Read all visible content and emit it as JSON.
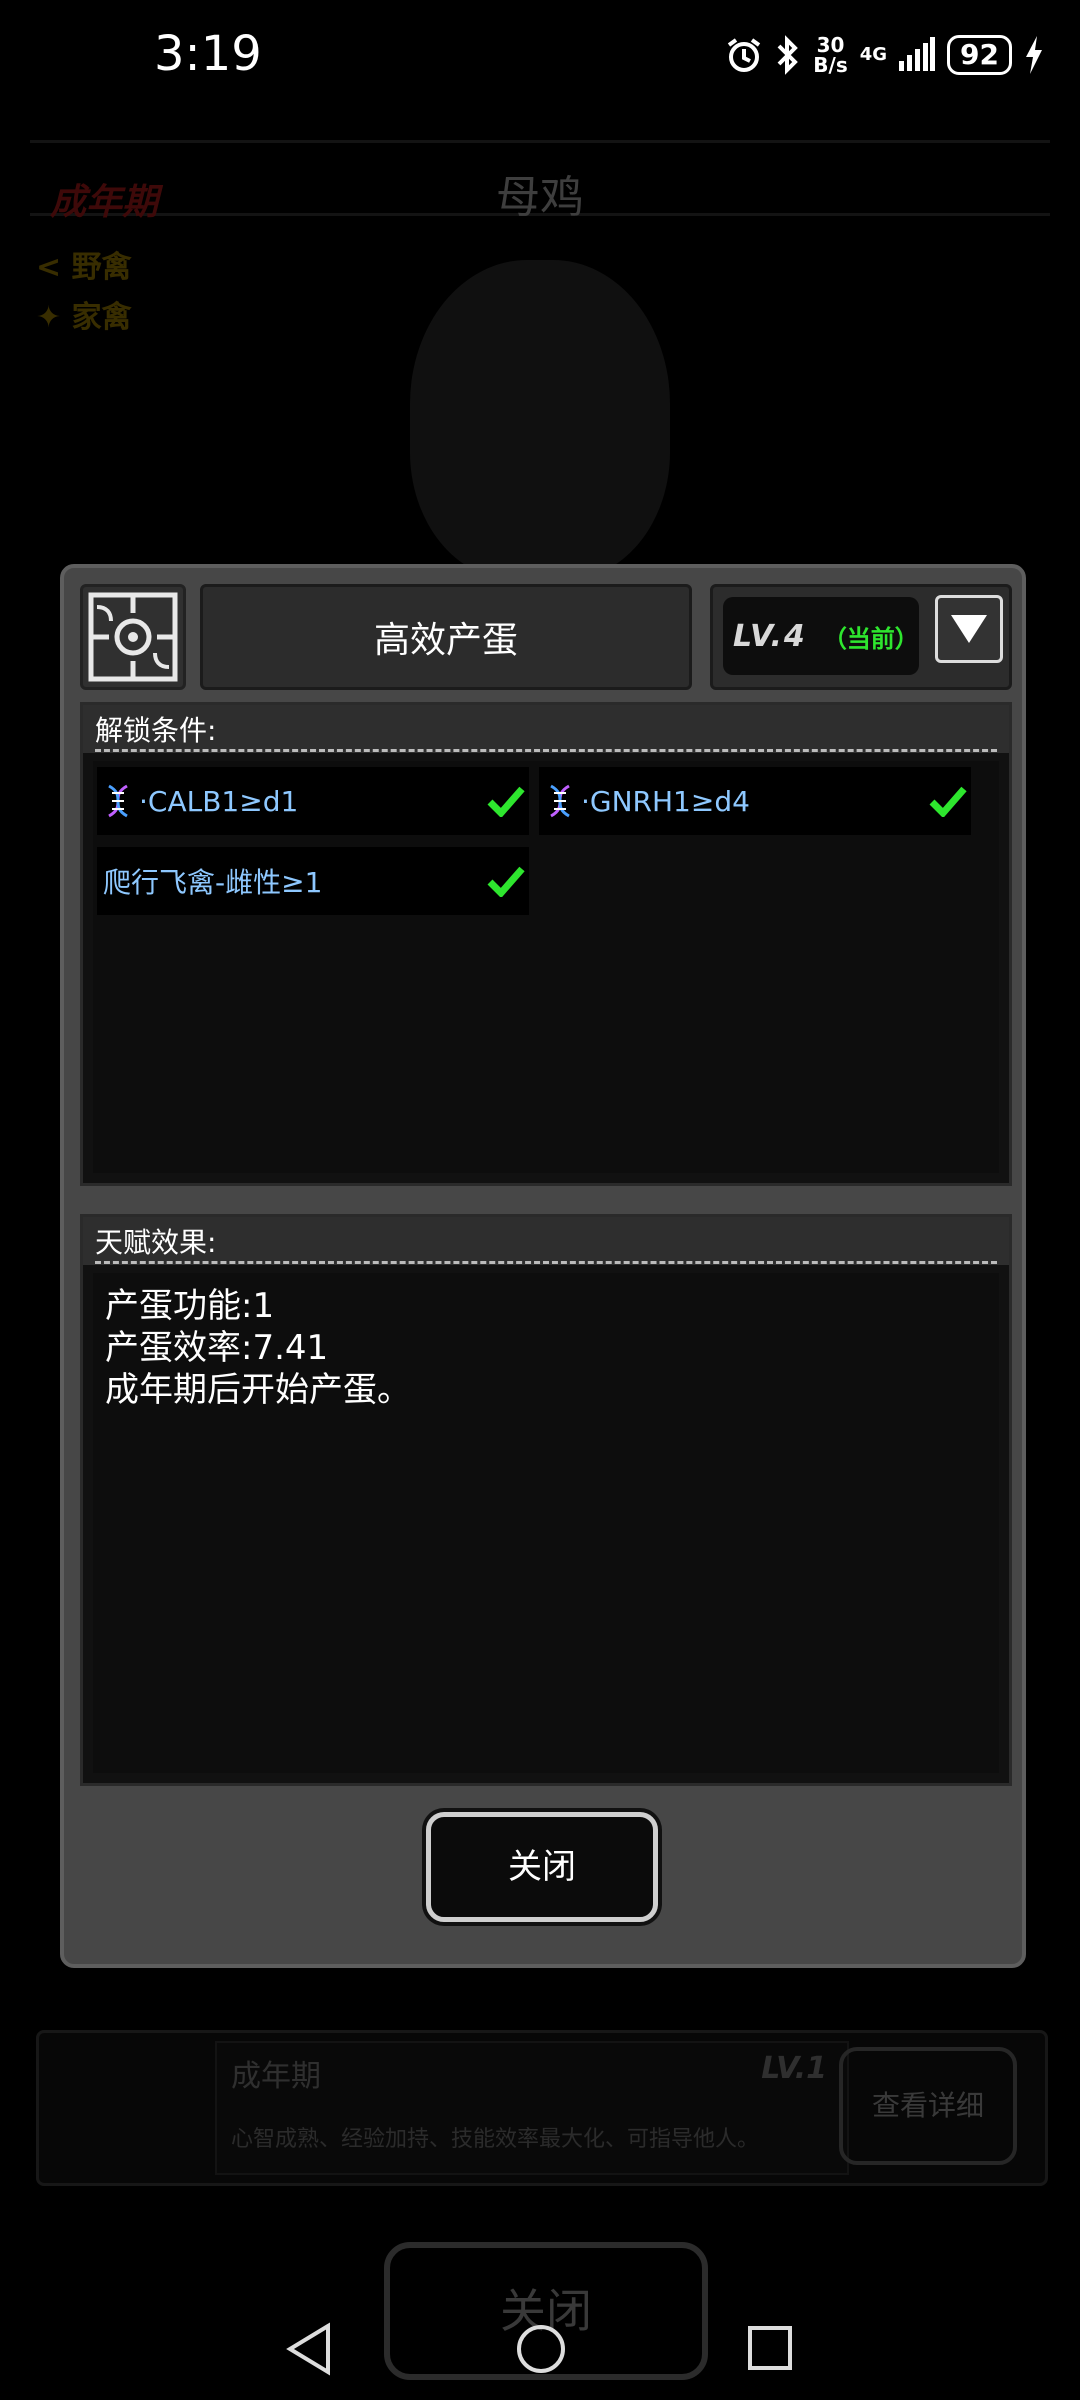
{
  "status_bar": {
    "time": "3:19",
    "speed_value": "30",
    "speed_unit": "B/s",
    "network": "4G",
    "battery": "92",
    "icons": [
      "alarm-icon",
      "bluetooth-icon",
      "signal-icon",
      "battery-icon",
      "charging-icon"
    ]
  },
  "background_page": {
    "stage": "成年期",
    "title": "母鸡",
    "tags": [
      "野禽",
      "家禽"
    ],
    "card": {
      "name": "成年期",
      "level": "LV.1",
      "description": "心智成熟、经验加持、技能效率最大化、可指导他人。",
      "button": "查看详细"
    },
    "close_button": "关闭"
  },
  "modal": {
    "talent_name": "高效产蛋",
    "level": "LV.4",
    "current_label": "（当前）",
    "unlock_label": "解锁条件:",
    "conditions": [
      {
        "text": "·CALB1≥d1",
        "has_dna_icon": true,
        "met": true
      },
      {
        "text": "·GNRH1≥d4",
        "has_dna_icon": true,
        "met": true
      },
      {
        "text": "爬行飞禽-雌性≥1",
        "has_dna_icon": false,
        "met": true
      }
    ],
    "effect_label": "天赋效果:",
    "effects": "产蛋功能:1\n产蛋效率:7.41\n成年期后开始产蛋。",
    "close_button": "关闭"
  },
  "colors": {
    "modal_bg": "#474747",
    "check_green": "#2ee62e",
    "condition_text": "#8ec8ff",
    "current_label": "#2ee62e"
  }
}
